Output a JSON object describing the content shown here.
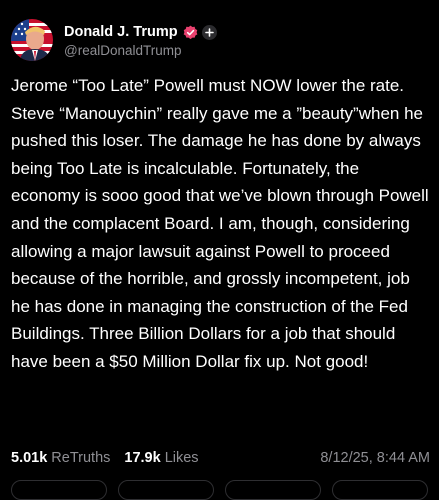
{
  "author": {
    "display_name": "Donald J. Trump",
    "handle": "@realDonaldTrump",
    "verified_badge_color": "#e9416f",
    "avatar_icon": "portrait-icon",
    "follow_icon": "plus-icon"
  },
  "post": {
    "text": "Jerome “Too Late” Powell must NOW lower the rate. Steve “Manouychin” really gave me a ”beauty”when he pushed this loser. The damage he has done by always being Too Late is incalculable. Fortunately, the economy is sooo good that we’ve blown through Powell and the complacent Board. I am, though, considering allowing a major lawsuit against Powell to proceed because of the horrible, and grossly incompetent, job he has done in managing the construction of the Fed Buildings. Three Billion Dollars for a job that should have been a $50 Million Dollar fix up. Not good!"
  },
  "stats": {
    "retruths_count": "5.01k",
    "retruths_label": "ReTruths",
    "likes_count": "17.9k",
    "likes_label": "Likes",
    "timestamp": "8/12/25, 8:44 AM"
  },
  "colors": {
    "background": "#000000",
    "text_primary": "#ffffff",
    "text_secondary": "#8f8f94"
  }
}
